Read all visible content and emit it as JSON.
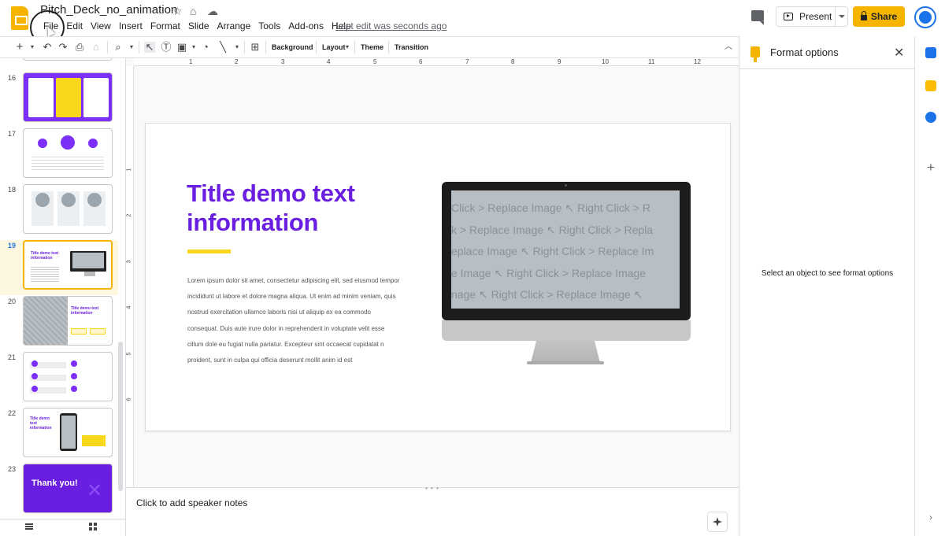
{
  "app": {
    "doc_title": "Pitch_Deck_no_animation",
    "menu": [
      "File",
      "Edit",
      "View",
      "Insert",
      "Format",
      "Slide",
      "Arrange",
      "Tools",
      "Add-ons",
      "Help"
    ],
    "last_edit": "Last edit was seconds ago",
    "present_label": "Present",
    "share_label": "Share"
  },
  "toolbar": {
    "background_label": "Background",
    "layout_label": "Layout",
    "theme_label": "Theme",
    "transition_label": "Transition"
  },
  "filmstrip": {
    "slides": [
      {
        "num": "16",
        "type": "purple-cards"
      },
      {
        "num": "17",
        "type": "circles"
      },
      {
        "num": "18",
        "type": "gray-circles"
      },
      {
        "num": "19",
        "type": "monitor",
        "selected": true
      },
      {
        "num": "20",
        "type": "pattern"
      },
      {
        "num": "21",
        "type": "checklist"
      },
      {
        "num": "22",
        "type": "phone"
      },
      {
        "num": "23",
        "type": "thank-you",
        "label": "Thank you!"
      }
    ],
    "slide19_thumb_title": "Title demo text information",
    "slide20_thumb_title": "Title demo text information",
    "slide22_thumb_title": "Title demo text information"
  },
  "ruler": {
    "h_ticks": [
      "1",
      "2",
      "3",
      "4",
      "5",
      "6",
      "7",
      "8",
      "9",
      "10",
      "11",
      "12"
    ],
    "v_ticks": [
      "1",
      "2",
      "3",
      "4",
      "5",
      "6"
    ]
  },
  "slide": {
    "title": "Title demo text information",
    "body": "Lorem ipsum dolor sit amet, consectetur adipiscing elit, sed eiusmod tempor incididunt ut labore et dolore magna aliqua. Ut enim ad minim veniam, quis nostrud exercitation ullamco laboris nisi ut aliquip ex ea commodo consequat. Duis aute irure dolor in reprehenderit in voluptate velit esse cillum dole eu fugiat nulla pariatur. Excepteur sint occaecat cupidatat n proident, sunt in culpa qui officia deserunt mollit anim id est",
    "screen_lines": [
      "Click > Replace Image ↖ Right Click > R",
      "k > Replace Image ↖ Right Click > Repla",
      "eplace Image ↖ Right Click > Replace Im",
      "e Image ↖ Right Click > Replace Image",
      "nage ↖ Right Click > Replace Image ↖"
    ]
  },
  "notes": {
    "placeholder": "Click to add speaker notes"
  },
  "format_panel": {
    "title": "Format options",
    "empty_message": "Select an object to see format options"
  },
  "colors": {
    "accent_purple": "#6a1ee0",
    "accent_yellow": "#f9d71c",
    "brand_yellow": "#f4b400"
  }
}
